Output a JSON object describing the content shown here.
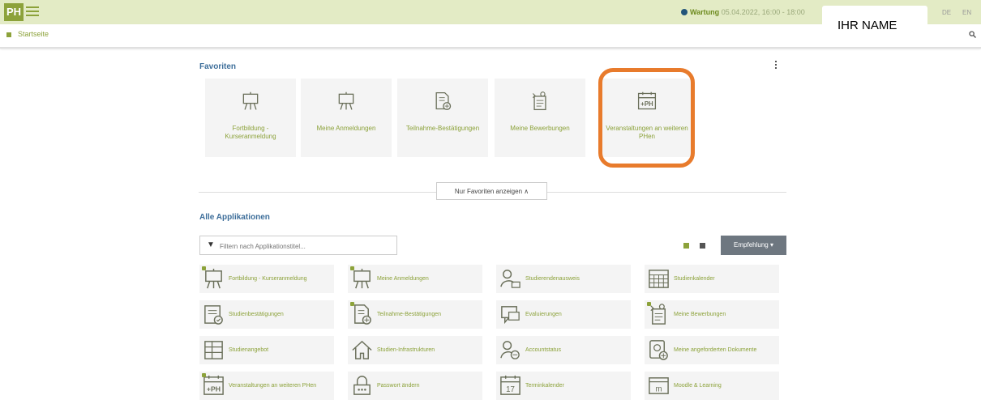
{
  "header": {
    "logo_text": "PH",
    "warning_label": "Wartung",
    "warning_time": "05.04.2022, 16:00 - 18:00",
    "user_name": "IHR NAME",
    "lang_de": "DE",
    "lang_en": "EN"
  },
  "breadcrumb": {
    "home": "Startseite"
  },
  "favorites": {
    "title": "Favoriten",
    "items": [
      {
        "label": "Fortbildung - Kurseranmeldung",
        "icon": "easel-icon"
      },
      {
        "label": "Meine Anmeldungen",
        "icon": "easel-icon"
      },
      {
        "label": "Teilnahme-Bestätigungen",
        "icon": "document-add-icon"
      },
      {
        "label": "Meine Bewerbungen",
        "icon": "application-icon"
      },
      {
        "label": "Veranstaltungen an weiteren PHen",
        "icon": "ph-calendar-icon"
      }
    ],
    "toggle_label": "Nur Favoriten anzeigen ∧"
  },
  "apps": {
    "title": "Alle Applikationen",
    "filter_placeholder": "Filtern nach Applikationstitel...",
    "sort_label": "Empfehlung ▾",
    "items": [
      {
        "label": "Fortbildung - Kurseranmeldung",
        "icon": "easel-icon",
        "starred": true
      },
      {
        "label": "Meine Anmeldungen",
        "icon": "easel-icon",
        "starred": true
      },
      {
        "label": "Studierendenausweis",
        "icon": "student-icon",
        "starred": false
      },
      {
        "label": "Studienkalender",
        "icon": "grid-calendar-icon",
        "starred": false
      },
      {
        "label": "Studienbestätigungen",
        "icon": "certificate-icon",
        "starred": false
      },
      {
        "label": "Teilnahme-Bestätigungen",
        "icon": "document-add-icon",
        "starred": true
      },
      {
        "label": "Evaluierungen",
        "icon": "feedback-icon",
        "starred": false
      },
      {
        "label": "Meine Bewerbungen",
        "icon": "application-icon",
        "starred": true
      },
      {
        "label": "Studienangebot",
        "icon": "catalog-icon",
        "starred": false
      },
      {
        "label": "Studien-Infrastrukturen",
        "icon": "home-icon",
        "starred": false
      },
      {
        "label": "Accountstatus",
        "icon": "account-icon",
        "starred": false
      },
      {
        "label": "Meine angeforderten Dokumente",
        "icon": "document-request-icon",
        "starred": false
      },
      {
        "label": "Veranstaltungen an weiteren PHen",
        "icon": "ph-calendar-icon",
        "starred": true
      },
      {
        "label": "Passwort ändern",
        "icon": "password-icon",
        "starred": false
      },
      {
        "label": "Terminkalender",
        "icon": "calendar-17-icon",
        "starred": false
      },
      {
        "label": "Moodle & Learning",
        "icon": "moodle-icon",
        "starred": false
      }
    ]
  },
  "colors": {
    "accent": "#8ca23a",
    "header_bg": "#e3ebc5",
    "highlight": "#e87b2c",
    "heading": "#3d6e9a"
  }
}
